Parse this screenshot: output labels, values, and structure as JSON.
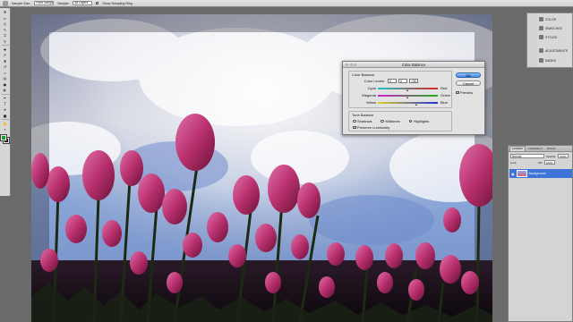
{
  "options_bar": {
    "sample_size_label": "Sample Size:",
    "sample_size_value": "Point Sample",
    "sample_label": "Sample:",
    "sample_value": "All Layers",
    "show_ring_label": "Show Sampling Ring"
  },
  "toolbox": {
    "tools": [
      "move-icon",
      "marquee-icon",
      "lasso-icon",
      "quick-select-icon",
      "crop-icon",
      "eyedropper-icon",
      "healing-icon",
      "brush-icon",
      "clone-stamp-icon",
      "history-brush-icon",
      "eraser-icon",
      "gradient-icon",
      "blur-icon",
      "dodge-icon",
      "pen-icon",
      "type-icon",
      "path-select-icon",
      "shape-icon",
      "hand-icon",
      "zoom-icon"
    ],
    "foreground_color": "#1a9a2a",
    "background_color": "#111111"
  },
  "dialog": {
    "title": "Color Balance",
    "group_title": "Color Balance",
    "levels_label": "Color Levels:",
    "levels": [
      "0",
      "0",
      "+30"
    ],
    "sliders": [
      {
        "left": "Cyan",
        "right": "Red",
        "value": 0,
        "gradient": [
          "#19c8c8",
          "#e02020"
        ]
      },
      {
        "left": "Magenta",
        "right": "Green",
        "value": 0,
        "gradient": [
          "#d020d0",
          "#20b020"
        ]
      },
      {
        "left": "Yellow",
        "right": "Blue",
        "value": 30,
        "gradient": [
          "#e0d020",
          "#2030e0"
        ]
      }
    ],
    "tone_title": "Tone Balance",
    "tones": [
      {
        "label": "Shadows",
        "selected": true
      },
      {
        "label": "Midtones",
        "selected": false
      },
      {
        "label": "Highlights",
        "selected": false
      }
    ],
    "preserve_label": "Preserve Luminosity",
    "preserve_checked": true,
    "ok_label": "OK",
    "cancel_label": "Cancel",
    "preview_label": "Preview",
    "preview_checked": true
  },
  "dock": {
    "items": [
      "COLOR",
      "SWATCHES",
      "STYLES",
      "ADJUSTMENTS",
      "MASKS"
    ]
  },
  "layers_panel": {
    "tabs": [
      "LAYERS",
      "CHANNELS",
      "PATHS"
    ],
    "blend_mode": "Normal",
    "opacity_label": "Opacity:",
    "opacity_value": "100%",
    "lock_label": "Lock:",
    "fill_label": "Fill:",
    "fill_value": "100%",
    "layer_name": "Background"
  }
}
